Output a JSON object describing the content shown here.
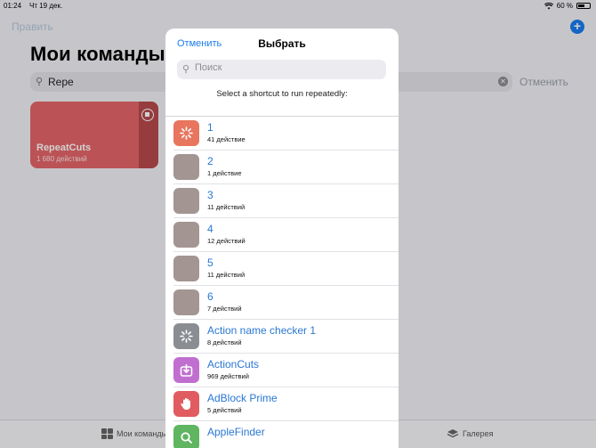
{
  "status_bar": {
    "time": "01:24",
    "date": "Чт 19 дек.",
    "battery": "60 %",
    "battery_level": 0.6
  },
  "background": {
    "edit_label": "Править",
    "title": "Мои команды",
    "search_value": "Repe",
    "cancel_label": "Отменить",
    "card": {
      "name": "RepeatCuts",
      "count": "1 680 действий",
      "color": "#e5666a"
    },
    "tabs": {
      "mine": "Мои команды",
      "gallery": "Галерея"
    }
  },
  "sheet": {
    "cancel_label": "Отменить",
    "title": "Выбрать",
    "search_placeholder": "Поиск",
    "prompt": "Select a shortcut to run repeatedly:",
    "items": [
      {
        "title": "1",
        "subtitle": "41 действие",
        "color": "#e8765f",
        "icon": "spinner-icon"
      },
      {
        "title": "2",
        "subtitle": "1 действие",
        "color": "#a39592",
        "icon": ""
      },
      {
        "title": "3",
        "subtitle": "11 действий",
        "color": "#a39592",
        "icon": ""
      },
      {
        "title": "4",
        "subtitle": "12 действий",
        "color": "#a39592",
        "icon": ""
      },
      {
        "title": "5",
        "subtitle": "11 действий",
        "color": "#a39592",
        "icon": ""
      },
      {
        "title": "6",
        "subtitle": "7 действий",
        "color": "#a39592",
        "icon": ""
      },
      {
        "title": "Action name checker 1",
        "subtitle": "8 действий",
        "color": "#8a8e93",
        "icon": "spinner-icon"
      },
      {
        "title": "ActionCuts",
        "subtitle": "969 действий",
        "color": "#c06fd0",
        "icon": "download-icon"
      },
      {
        "title": "AdBlock Prime",
        "subtitle": "5 действий",
        "color": "#e05c60",
        "icon": "hand-icon"
      },
      {
        "title": "AppleFinder",
        "subtitle": "",
        "color": "#5fb560",
        "icon": "search-icon"
      }
    ]
  }
}
